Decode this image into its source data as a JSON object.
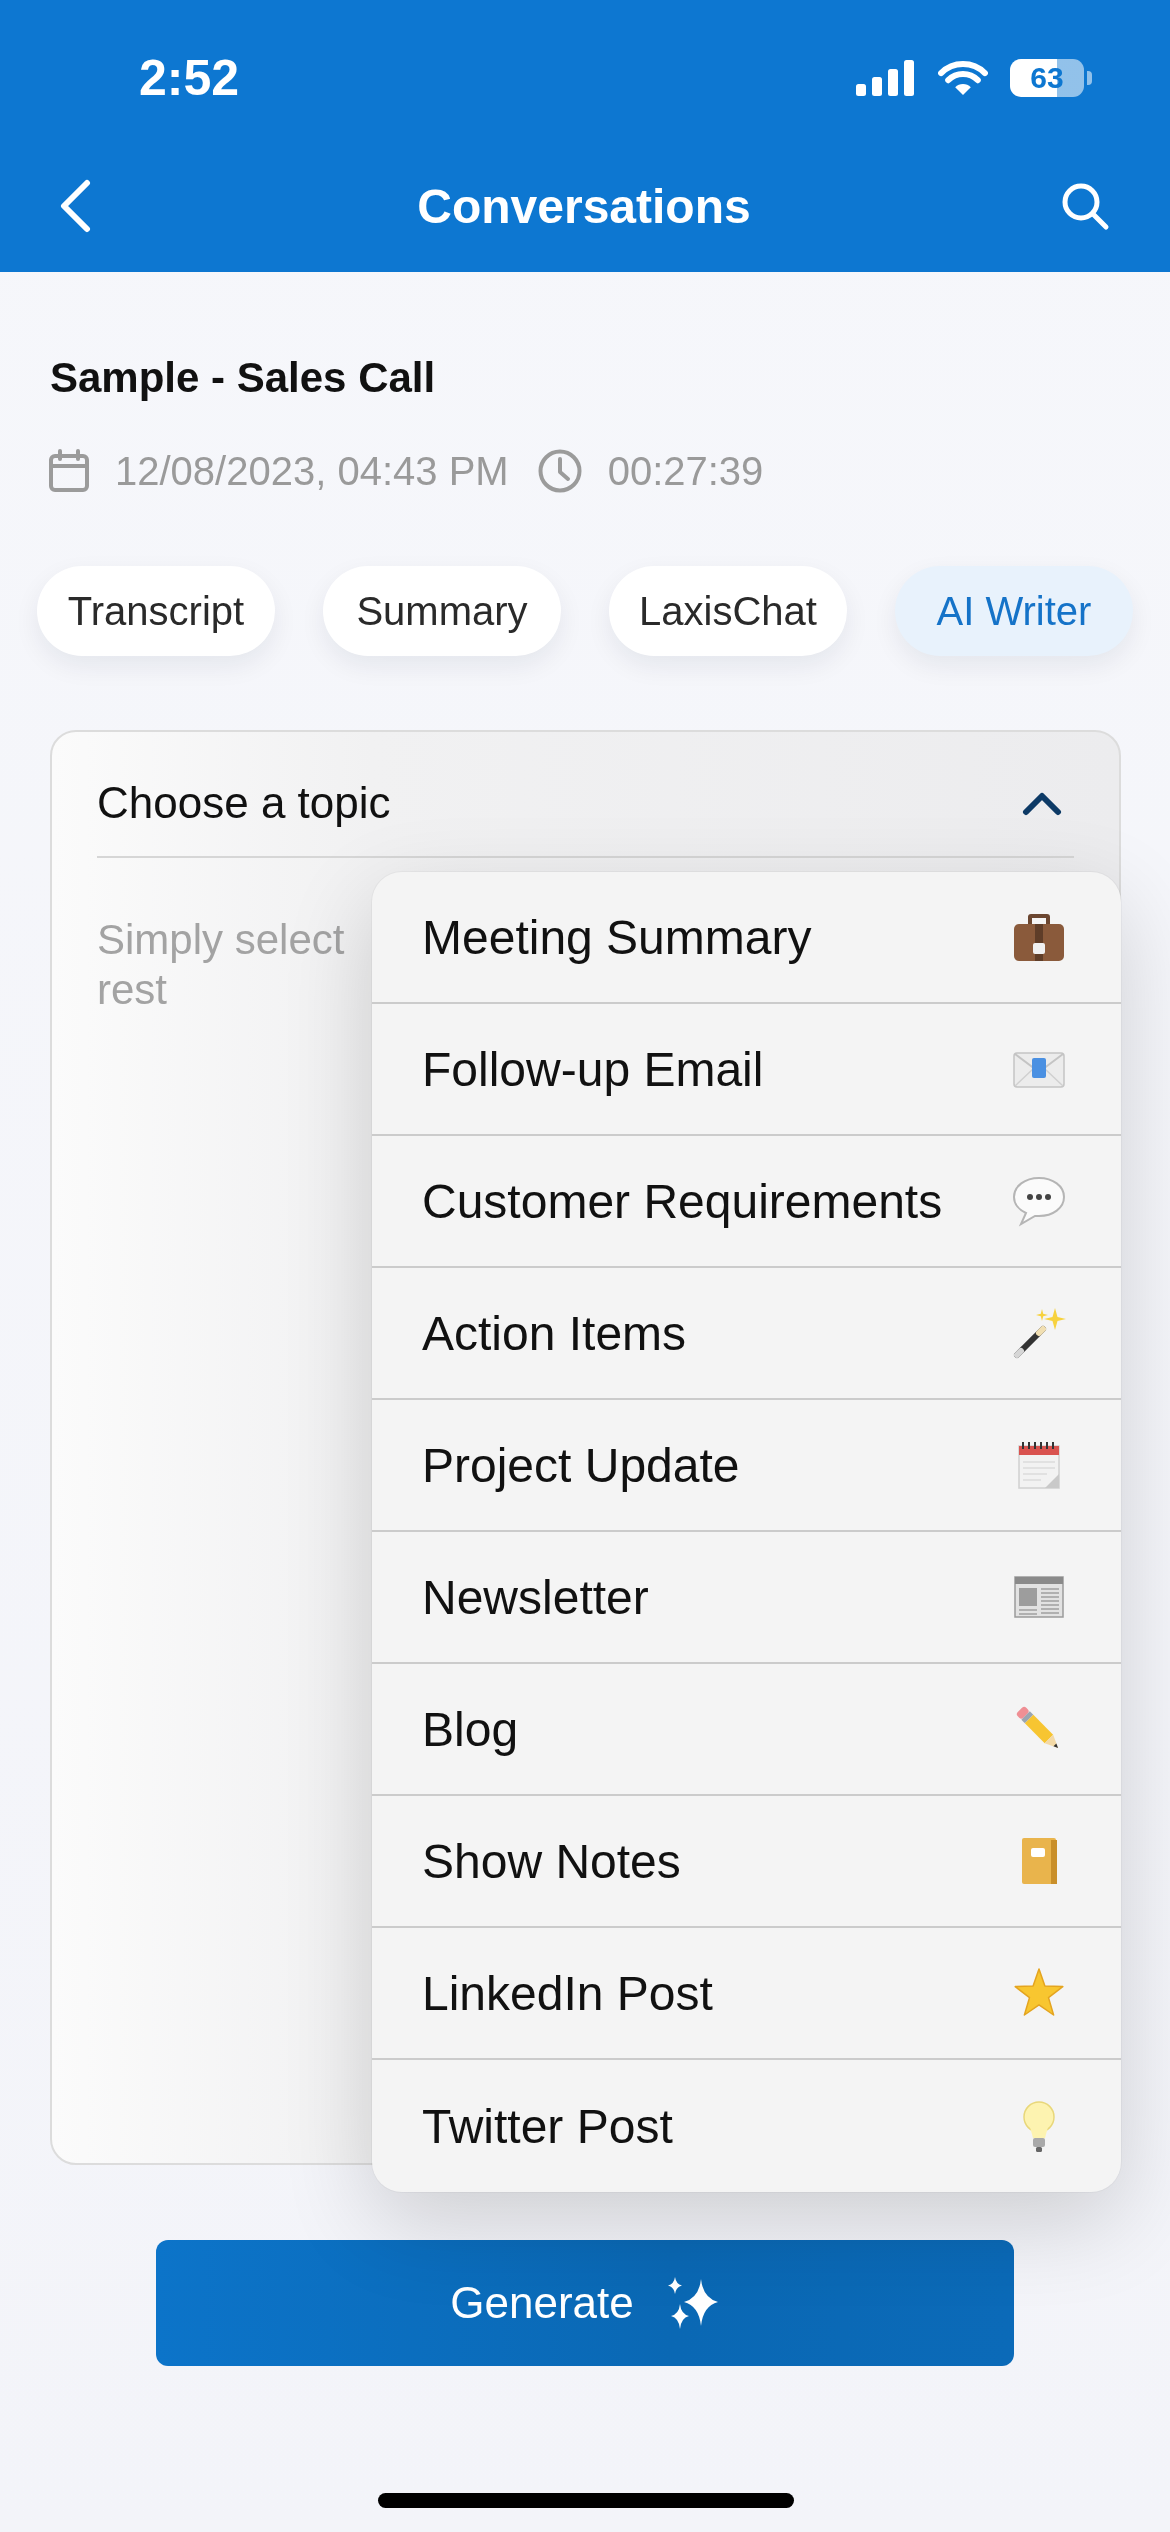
{
  "status_bar": {
    "time": "2:52",
    "battery": "63"
  },
  "nav_bar": {
    "title": "Conversations"
  },
  "conversation": {
    "title": "Sample - Sales Call",
    "date": "12/08/2023, 04:43 PM",
    "duration": "00:27:39"
  },
  "tabs": [
    {
      "label": "Transcript",
      "selected": false
    },
    {
      "label": "Summary",
      "selected": false
    },
    {
      "label": "LaxisChat",
      "selected": false
    },
    {
      "label": "AI Writer",
      "selected": true
    }
  ],
  "topic_select": {
    "label": "Choose a topic",
    "expanded": true,
    "hint_lines": [
      "Simply select",
      "rest"
    ],
    "options": [
      {
        "label": "Meeting Summary",
        "selected": false
      },
      {
        "label": "Follow-up Email",
        "selected": false
      },
      {
        "label": "Customer Requirements",
        "selected": false
      },
      {
        "label": "Action Items",
        "selected": false
      },
      {
        "label": "Project Update",
        "selected": false
      },
      {
        "label": "Newsletter",
        "selected": false
      },
      {
        "label": "Blog",
        "selected": false
      },
      {
        "label": "Show Notes",
        "selected": false
      },
      {
        "label": "LinkedIn Post",
        "selected": false
      },
      {
        "label": "Twitter Post",
        "selected": false
      }
    ]
  },
  "generate_button": {
    "label": "Generate"
  }
}
